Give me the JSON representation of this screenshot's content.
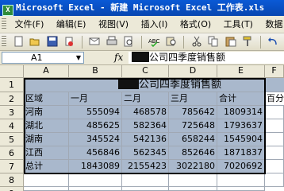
{
  "window": {
    "title": "Microsoft Excel - 新建 Microsoft Excel 工作表.xls"
  },
  "menu": [
    "文件(F)",
    "编辑(E)",
    "视图(V)",
    "插入(I)",
    "格式(O)",
    "工具(T)",
    "数据"
  ],
  "toolbar": {
    "icons": [
      "new-icon",
      "open-icon",
      "save-icon",
      "permission-icon",
      "email-icon",
      "print-icon",
      "print-preview-icon",
      "spelling-icon",
      "research-icon",
      "cut-icon",
      "copy-icon",
      "paste-icon",
      "format-painter-icon",
      "undo-icon",
      "redo-icon"
    ]
  },
  "formula_bar": {
    "name_box": "A1",
    "fx_label": "fx",
    "content": "公司四季度销售额"
  },
  "sheet": {
    "columns": [
      "A",
      "B",
      "C",
      "D",
      "E",
      "F"
    ],
    "rows": [
      "1",
      "2",
      "3",
      "4",
      "5",
      "6",
      "7",
      "8",
      "9"
    ],
    "title": "公司四季度销售额",
    "headers": [
      "区域",
      "一月",
      "二月",
      "三月",
      "合计",
      "百分"
    ],
    "data": [
      [
        "河南",
        "555094",
        "468578",
        "785642",
        "1809314"
      ],
      [
        "湖北",
        "485625",
        "582364",
        "725648",
        "1793637"
      ],
      [
        "湖南",
        "345524",
        "542136",
        "658244",
        "1545904"
      ],
      [
        "江西",
        "456846",
        "562345",
        "852646",
        "1871837"
      ],
      [
        "总计",
        "1843089",
        "2155423",
        "3022180",
        "7020692"
      ]
    ]
  }
}
